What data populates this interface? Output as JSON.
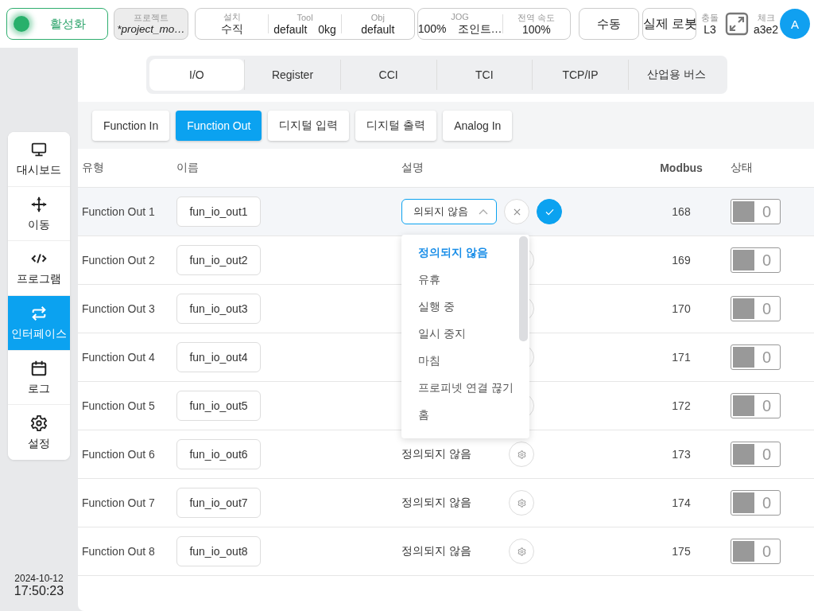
{
  "top_bar": {
    "activate": {
      "label": "활성화",
      "on": true
    },
    "project": {
      "label": "프로젝트",
      "value": "*project_mo…"
    },
    "setup": [
      {
        "label": "설치",
        "values": [
          "수직"
        ]
      },
      {
        "label": "Tool",
        "values": [
          "default",
          "0kg"
        ]
      },
      {
        "label": "Obj",
        "values": [
          "default"
        ]
      }
    ],
    "jog": [
      {
        "label": "JOG",
        "values": [
          "100%",
          "조인트…"
        ]
      },
      {
        "label": "전역 속도",
        "values": [
          "100%"
        ]
      }
    ],
    "mode_button": "수동",
    "robot_button": "실제 로봇",
    "collision": {
      "label": "충돌",
      "value": "L3"
    },
    "check": {
      "label": "체크",
      "value": "a3e2"
    },
    "avatar": "A"
  },
  "sidebar": {
    "items": [
      {
        "label": "대시보드",
        "selected": false
      },
      {
        "label": "이동",
        "selected": false
      },
      {
        "label": "프로그램",
        "selected": false
      },
      {
        "label": "인터페이스",
        "selected": true
      },
      {
        "label": "로그",
        "selected": false
      },
      {
        "label": "설정",
        "selected": false
      }
    ],
    "date": "2024-10-12",
    "time": "17:50:23"
  },
  "tabs": [
    {
      "label": "I/O",
      "selected": true
    },
    {
      "label": "Register",
      "selected": false
    },
    {
      "label": "CCI",
      "selected": false
    },
    {
      "label": "TCI",
      "selected": false
    },
    {
      "label": "TCP/IP",
      "selected": false
    },
    {
      "label": "산업용 버스",
      "selected": false
    }
  ],
  "subtabs": [
    {
      "label": "Function In",
      "selected": false
    },
    {
      "label": "Function Out",
      "selected": true
    },
    {
      "label": "디지털 입력",
      "selected": false
    },
    {
      "label": "디지털 출력",
      "selected": false
    },
    {
      "label": "Analog In",
      "selected": false
    }
  ],
  "table": {
    "columns": [
      "유형",
      "이름",
      "설명",
      "Modbus",
      "상태"
    ],
    "rows": [
      {
        "type": "Function Out 1",
        "name": "fun_io_out1",
        "editing": true,
        "description": "의되지 않음",
        "modbus": "168",
        "on": false,
        "value": "0"
      },
      {
        "type": "Function Out 2",
        "name": "fun_io_out2",
        "editing": false,
        "modbus": "169",
        "on": false,
        "value": "0"
      },
      {
        "type": "Function Out 3",
        "name": "fun_io_out3",
        "editing": false,
        "modbus": "170",
        "on": false,
        "value": "0"
      },
      {
        "type": "Function Out 4",
        "name": "fun_io_out4",
        "editing": false,
        "modbus": "171",
        "on": false,
        "value": "0"
      },
      {
        "type": "Function Out 5",
        "name": "fun_io_out5",
        "editing": false,
        "modbus": "172",
        "on": false,
        "value": "0"
      },
      {
        "type": "Function Out 6",
        "name": "fun_io_out6",
        "editing": false,
        "description": "정의되지 않음",
        "modbus": "173",
        "on": false,
        "value": "0"
      },
      {
        "type": "Function Out 7",
        "name": "fun_io_out7",
        "editing": false,
        "description": "정의되지 않음",
        "modbus": "174",
        "on": false,
        "value": "0"
      },
      {
        "type": "Function Out 8",
        "name": "fun_io_out8",
        "editing": false,
        "description": "정의되지 않음",
        "modbus": "175",
        "on": false,
        "value": "0"
      }
    ]
  },
  "dropdown": {
    "options": [
      {
        "label": "정의되지 않음",
        "selected": true
      },
      {
        "label": "유휴",
        "selected": false
      },
      {
        "label": "실행 중",
        "selected": false
      },
      {
        "label": "일시 중지",
        "selected": false
      },
      {
        "label": "마침",
        "selected": false
      },
      {
        "label": "프로피넷 연결 끊기",
        "selected": false
      },
      {
        "label": "홈",
        "selected": false
      }
    ]
  }
}
